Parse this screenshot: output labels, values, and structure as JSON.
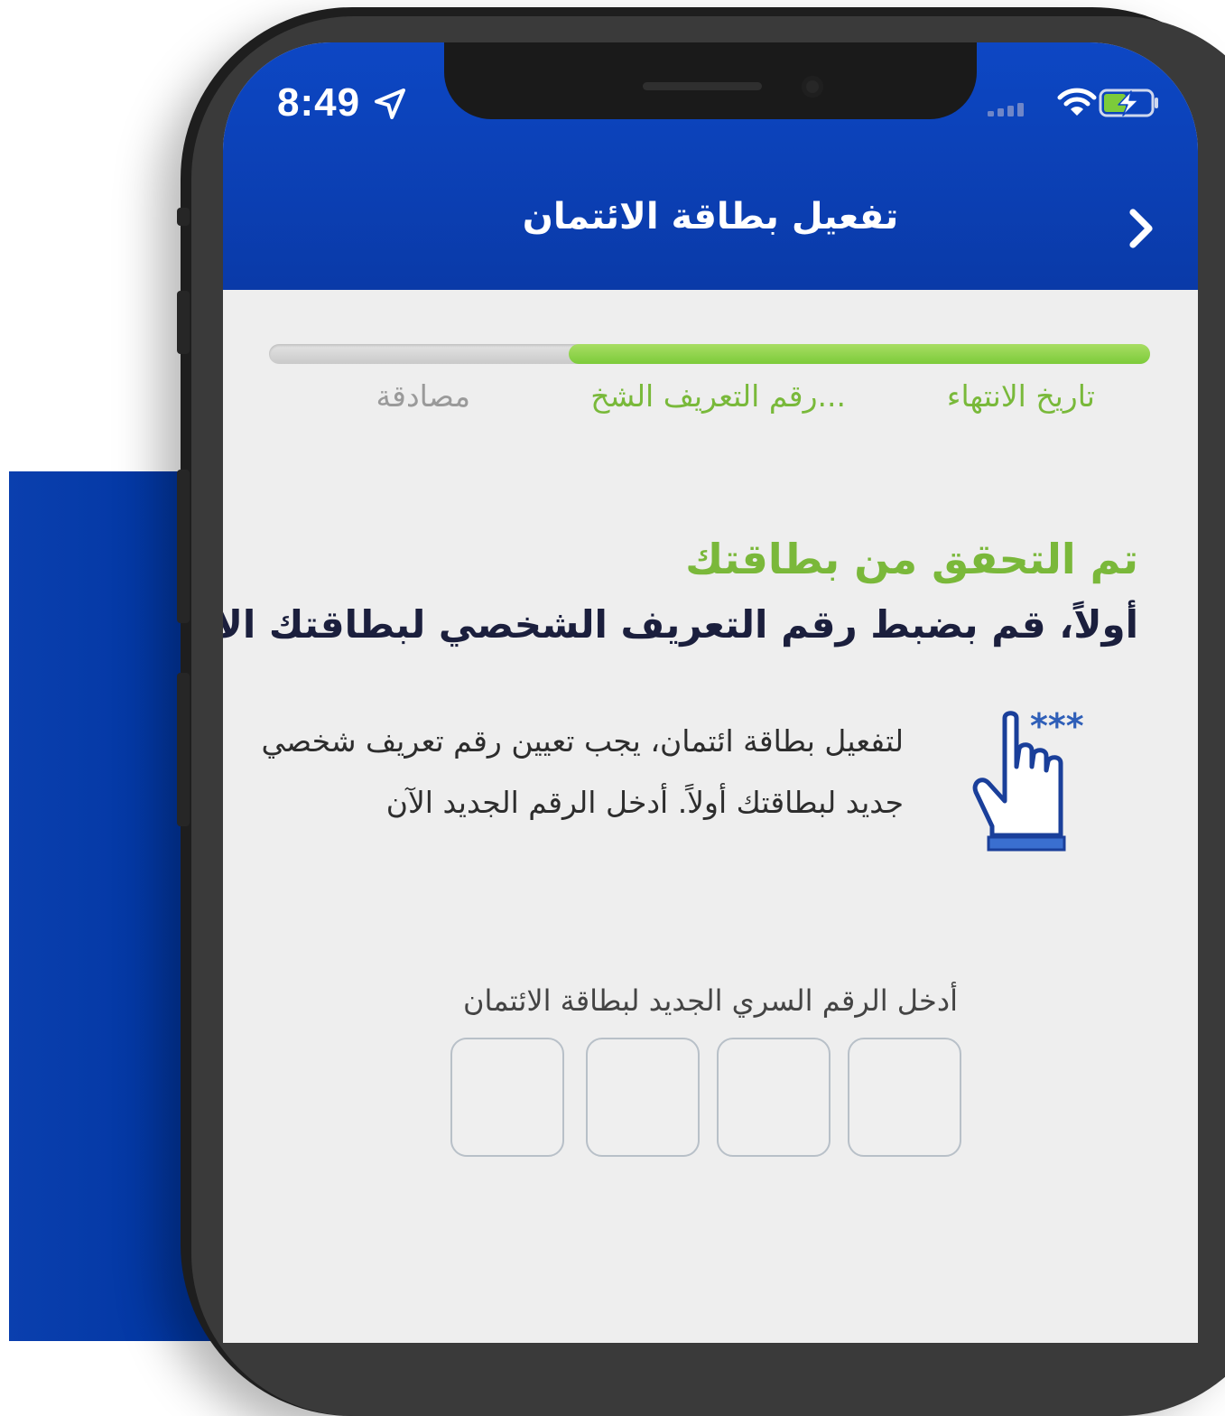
{
  "status_bar": {
    "time": "8:49",
    "icons": [
      "location-arrow-icon",
      "cellular-signal-icon",
      "wifi-icon",
      "battery-charging-icon"
    ]
  },
  "header": {
    "title": "تفعيل بطاقة الائتمان",
    "back_icon": "chevron-right-icon"
  },
  "progress": {
    "completed_fraction": 0.66,
    "steps": [
      {
        "label": "تاريخ الانتهاء",
        "state": "completed"
      },
      {
        "label": "رقم التعريف الشخ...",
        "state": "active"
      },
      {
        "label": "مصادقة",
        "state": "pending"
      }
    ]
  },
  "content": {
    "heading": "تم التحقق من بطاقتك",
    "subheading": "أولاً، قم بضبط رقم التعريف الشخصي لبطاقتك الائتمانية",
    "description": "لتفعيل بطاقة ائتمان، يجب تعيين رقم تعريف شخصي جديد لبطاقتك أولاً. أدخل الرقم الجديد الآن",
    "illustration_icon": "hand-pointer-pin-icon",
    "illustration_text": "***"
  },
  "pin_entry": {
    "label": "أدخل الرقم السري الجديد لبطاقة الائتمان",
    "digits": 4
  },
  "colors": {
    "brand_blue": "#0a3aa8",
    "accent_green": "#7ab83a",
    "text_dark": "#1b1f3d",
    "screen_bg": "#eeeeee"
  }
}
